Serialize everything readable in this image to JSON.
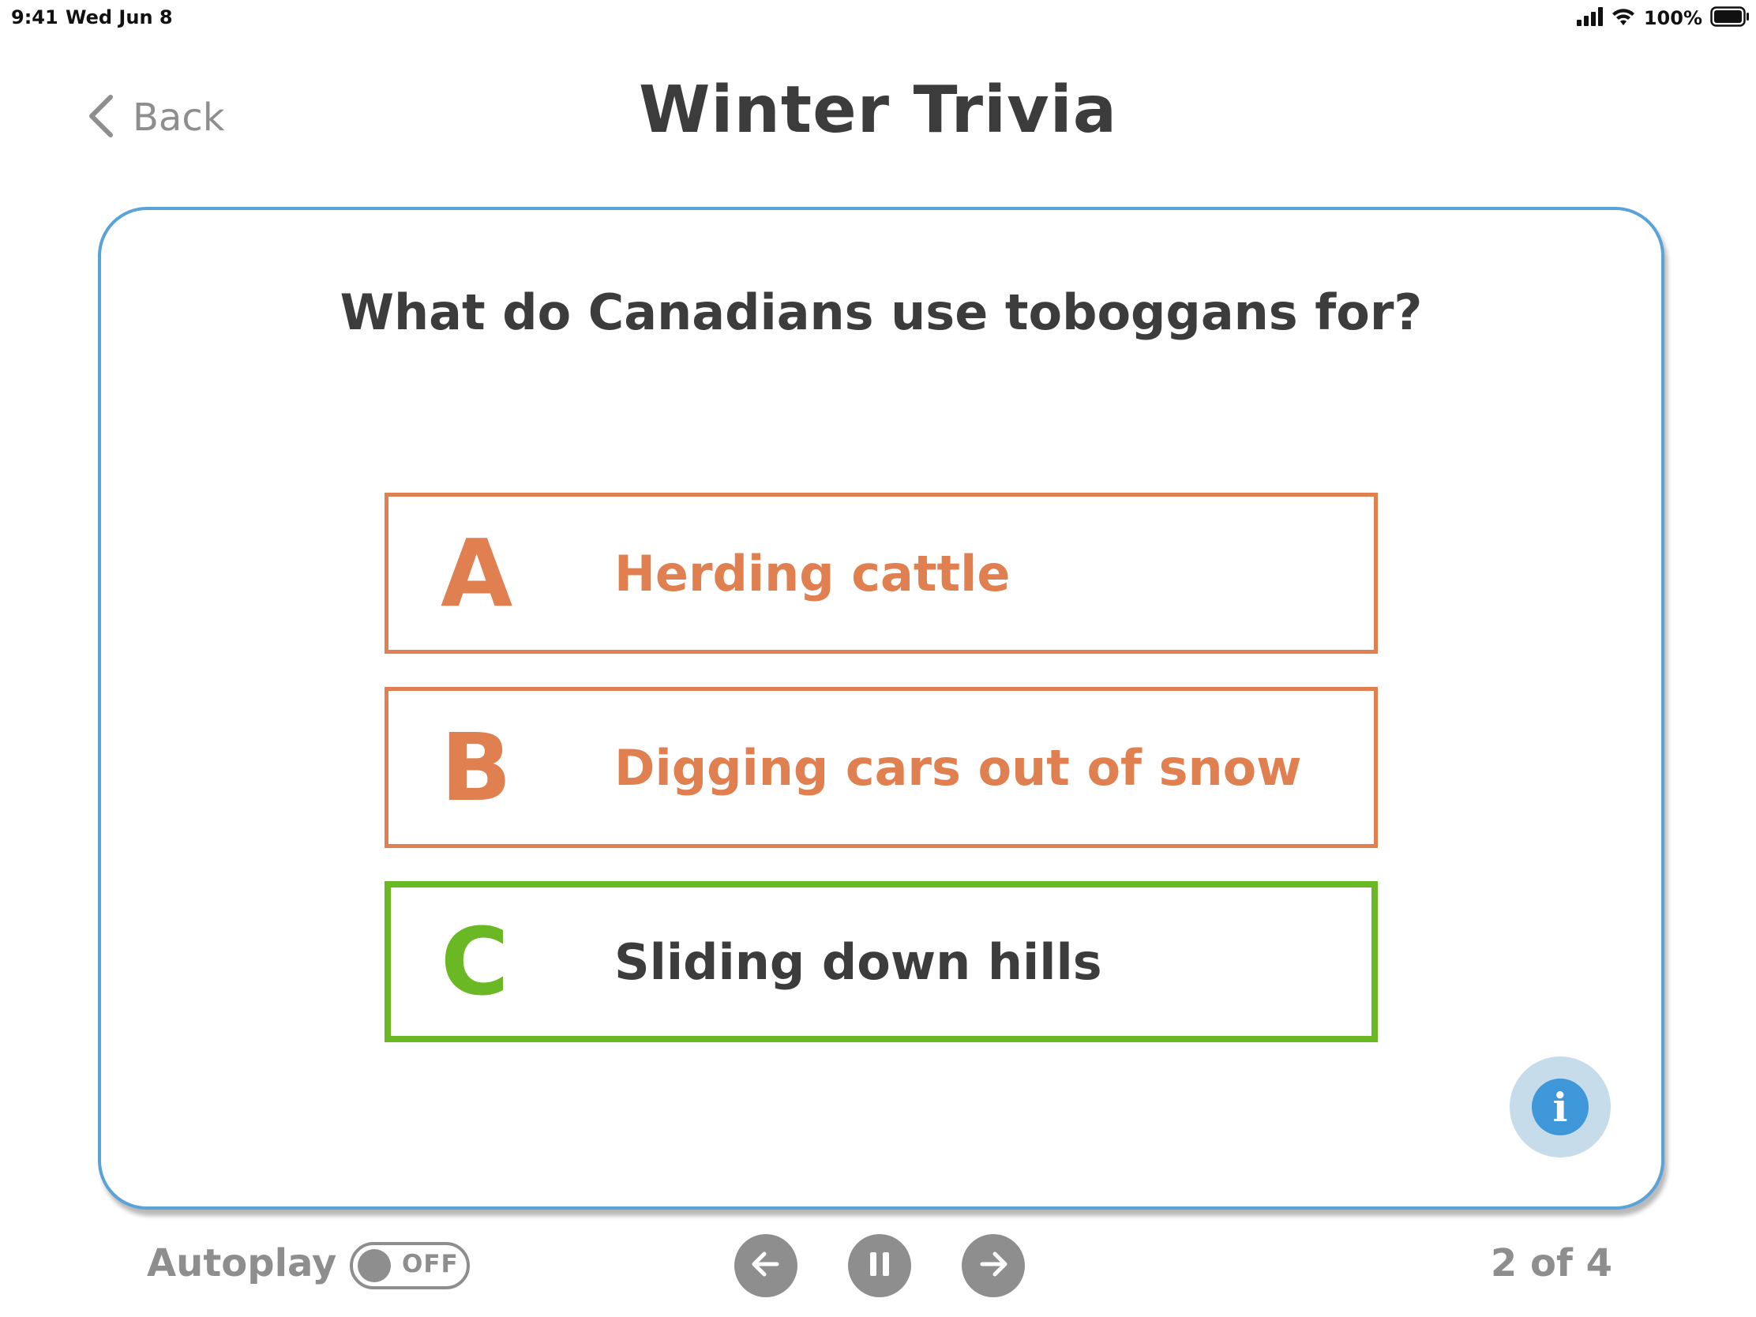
{
  "status_bar": {
    "time": "9:41",
    "date": "Wed Jun 8",
    "battery": "100%"
  },
  "header": {
    "back_label": "Back",
    "title": "Winter Trivia"
  },
  "question": {
    "text": "What do Canadians use toboggans for?"
  },
  "answers": [
    {
      "letter": "A",
      "text": "Herding cattle",
      "state": "incorrect"
    },
    {
      "letter": "B",
      "text": "Digging cars out of snow",
      "state": "incorrect"
    },
    {
      "letter": "C",
      "text": "Sliding down hills",
      "state": "correct"
    }
  ],
  "info": {
    "icon": "info-icon",
    "glyph": "i"
  },
  "footer": {
    "autoplay_label": "Autoplay",
    "autoplay_state": "OFF",
    "page_indicator": "2 of 4"
  },
  "colors": {
    "card_border": "#5aa3d8",
    "incorrect": "#e08050",
    "correct": "#6ab823",
    "info_button": "#3e97d9",
    "muted": "#8e8e8e"
  }
}
